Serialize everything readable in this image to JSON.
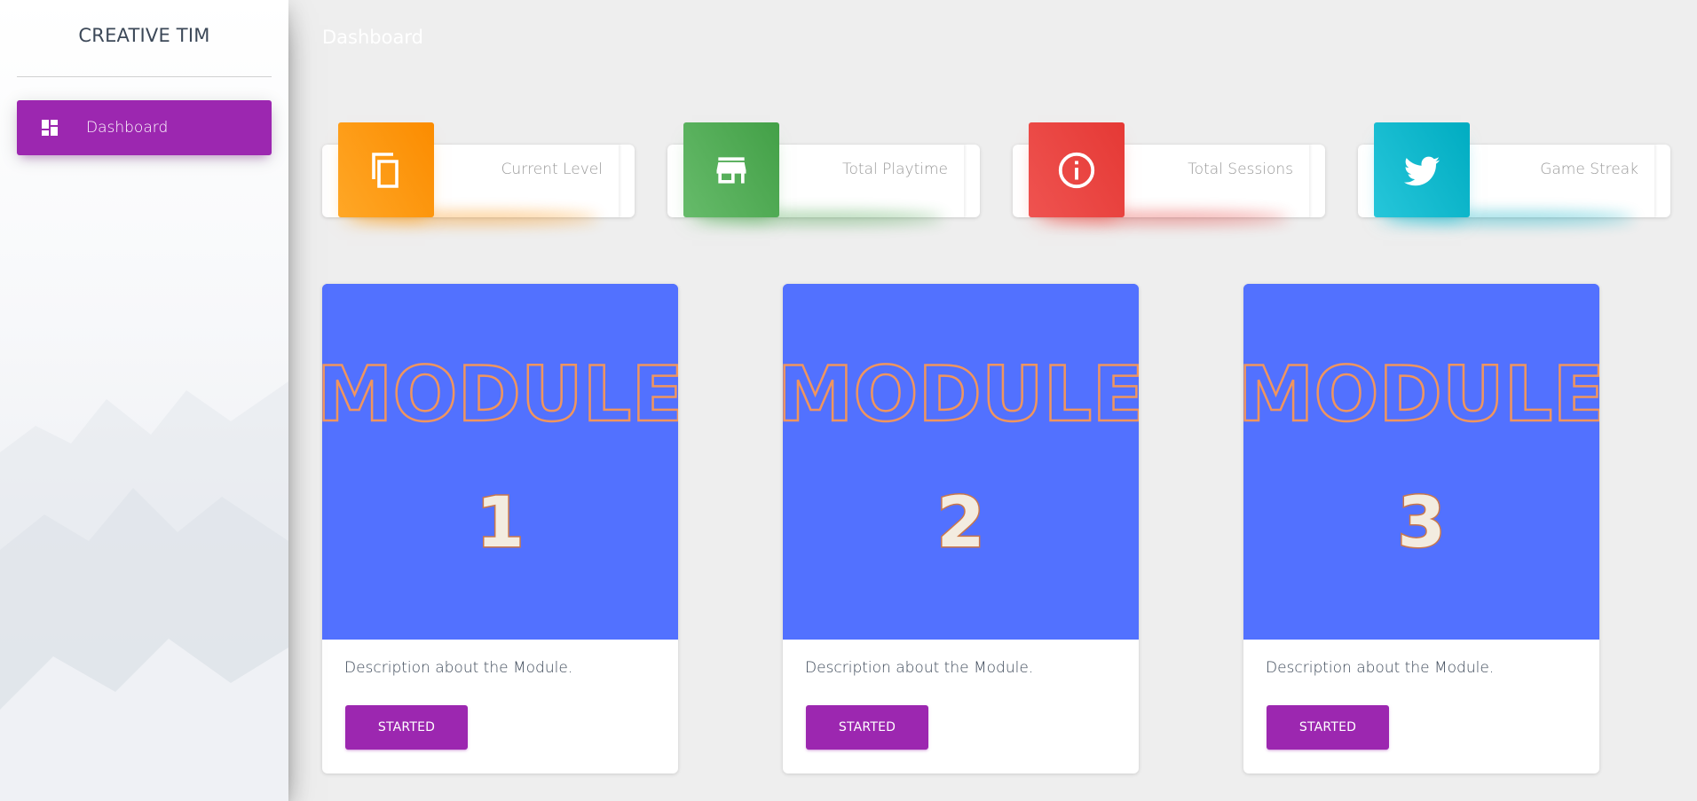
{
  "sidebar": {
    "brand": "CREATIVE TIM",
    "items": [
      {
        "label": "Dashboard",
        "icon": "dashboard-icon",
        "active": true
      }
    ]
  },
  "topbar": {
    "title": "Dashboard"
  },
  "stats": [
    {
      "label": "Current Level",
      "icon": "copy-icon",
      "color": "#fb8c00"
    },
    {
      "label": "Total Playtime",
      "icon": "store-icon",
      "color": "#43a047"
    },
    {
      "label": "Total Sessions",
      "icon": "info-icon",
      "color": "#e53935"
    },
    {
      "label": "Game Streak",
      "icon": "twitter-icon",
      "color": "#00acc1"
    }
  ],
  "modules": [
    {
      "title": "MODULE",
      "number": "1",
      "description": "Description about the Module.",
      "button": "STARTED"
    },
    {
      "title": "MODULE",
      "number": "2",
      "description": "Description about the Module.",
      "button": "STARTED"
    },
    {
      "title": "MODULE",
      "number": "3",
      "description": "Description about the Module.",
      "button": "STARTED"
    }
  ],
  "colors": {
    "primary": "#9c27b0",
    "module_bg": "#5271ff",
    "module_outline": "#f0955e",
    "number_fill": "#f3ece0"
  }
}
